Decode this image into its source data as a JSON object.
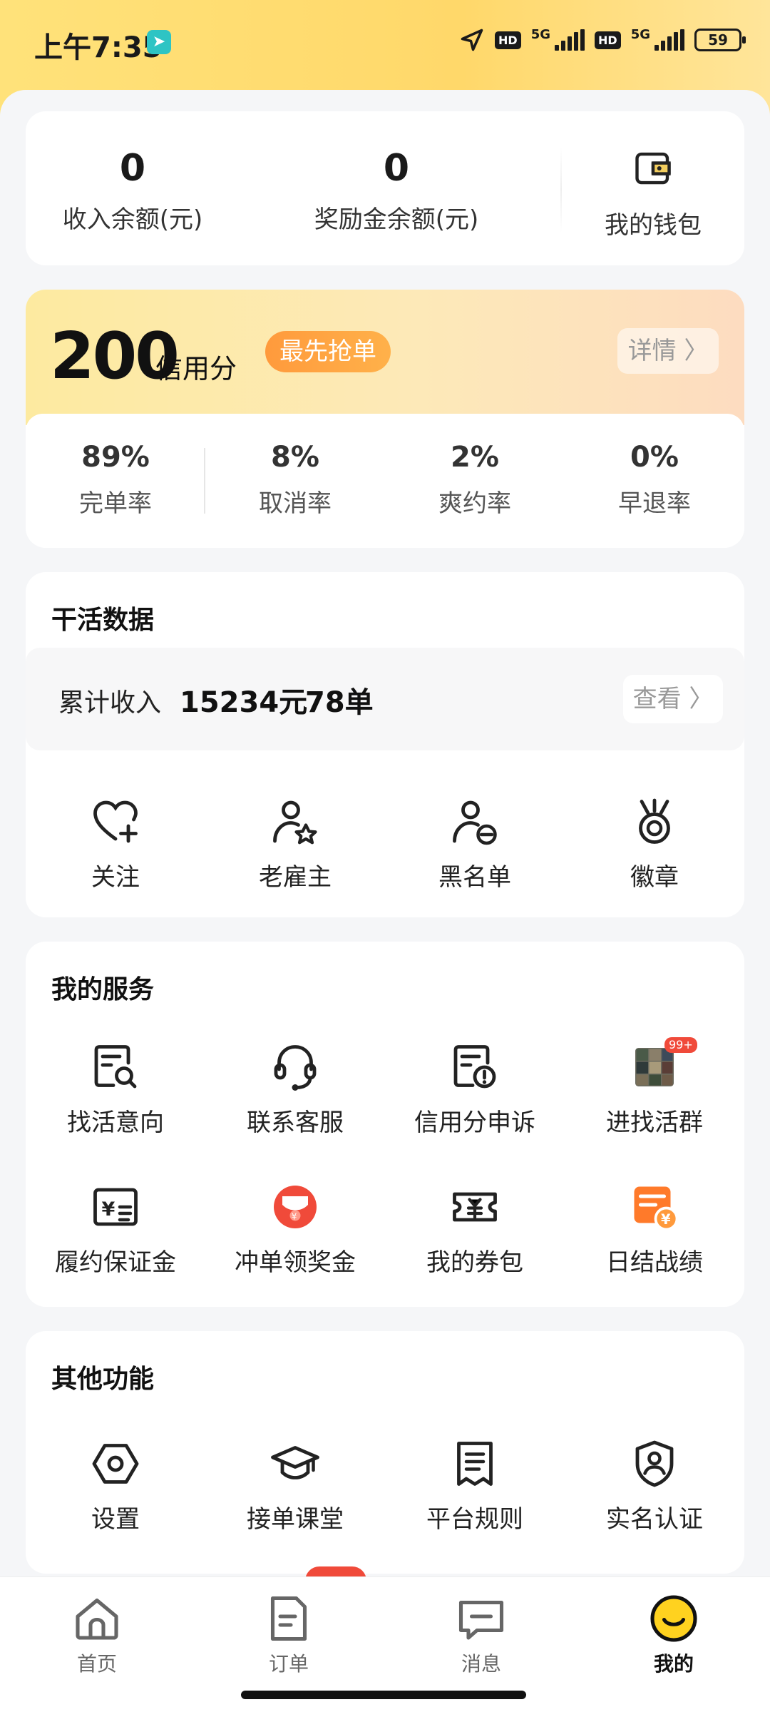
{
  "status_bar": {
    "time": "上午7:35",
    "network1": "5G",
    "network2": "5G",
    "hd": "HD",
    "battery": "59"
  },
  "wallet": {
    "income_balance_value": "0",
    "income_balance_label": "收入余额(元)",
    "reward_balance_value": "0",
    "reward_balance_label": "奖励金余额(元)",
    "my_wallet_label": "我的钱包"
  },
  "credit": {
    "score": "200",
    "unit": "信用分",
    "badge": "最先抢单",
    "detail_label": "详情 〉",
    "rates": [
      {
        "value": "89%",
        "label": "完单率"
      },
      {
        "value": "8%",
        "label": "取消率"
      },
      {
        "value": "2%",
        "label": "爽约率"
      },
      {
        "value": "0%",
        "label": "早退率"
      }
    ]
  },
  "work_data": {
    "title": "干活数据",
    "income_label": "累计收入",
    "income_value": "15234元",
    "orders_value": "78单",
    "view_label": "查看 〉",
    "items": [
      {
        "label": "关注",
        "icon": "heart-plus-icon"
      },
      {
        "label": "老雇主",
        "icon": "user-star-icon"
      },
      {
        "label": "黑名单",
        "icon": "user-block-icon"
      },
      {
        "label": "徽章",
        "icon": "medal-icon"
      }
    ]
  },
  "services": {
    "title": "我的服务",
    "items": [
      {
        "label": "找活意向",
        "icon": "search-doc-icon"
      },
      {
        "label": "联系客服",
        "icon": "headset-icon"
      },
      {
        "label": "信用分申诉",
        "icon": "appeal-doc-icon"
      },
      {
        "label": "进找活群",
        "icon": "group-thumbnail-icon",
        "badge": "99+"
      },
      {
        "label": "履约保证金",
        "icon": "deposit-icon"
      },
      {
        "label": "冲单领奖金",
        "icon": "red-envelope-icon"
      },
      {
        "label": "我的券包",
        "icon": "coupon-icon"
      },
      {
        "label": "日结战绩",
        "icon": "daily-record-icon"
      }
    ]
  },
  "others": {
    "title": "其他功能",
    "items": [
      {
        "label": "设置",
        "icon": "settings-icon"
      },
      {
        "label": "接单课堂",
        "icon": "graduation-cap-icon"
      },
      {
        "label": "平台规则",
        "icon": "rules-doc-icon"
      },
      {
        "label": "实名认证",
        "icon": "verified-user-icon"
      }
    ]
  },
  "tabbar": {
    "items": [
      {
        "label": "首页",
        "icon": "home-icon"
      },
      {
        "label": "订单",
        "icon": "order-icon"
      },
      {
        "label": "消息",
        "icon": "message-icon"
      },
      {
        "label": "我的",
        "icon": "profile-face-icon",
        "active": true
      }
    ]
  },
  "colors": {
    "accent_yellow": "#ffd86a",
    "badge_orange": "#ff9a3c",
    "red": "#f04a3a"
  }
}
